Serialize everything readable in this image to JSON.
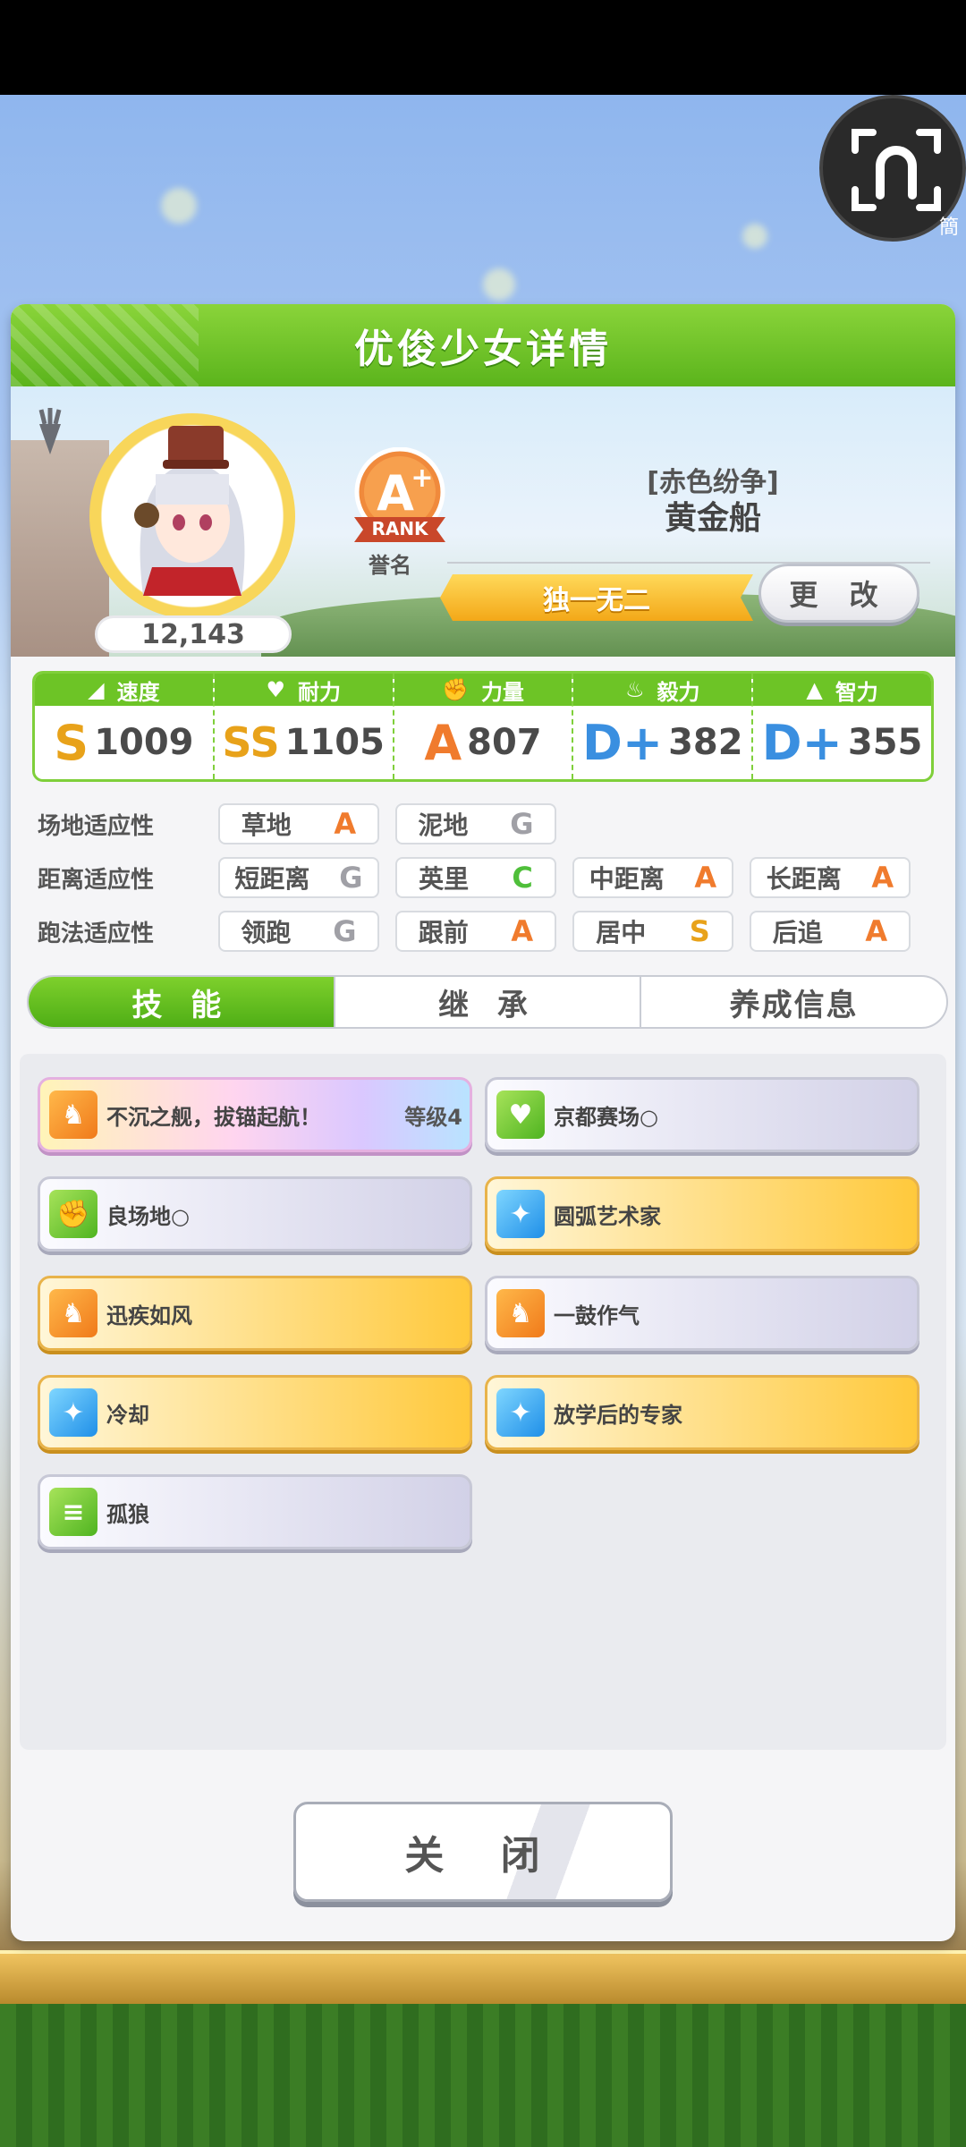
{
  "float_button": {
    "lang": "簡"
  },
  "panel": {
    "title": "优俊少女详情"
  },
  "profile": {
    "fans": "12,143",
    "rank_label": "RANK",
    "rank_grade": "A+",
    "rank_caption": "誉名",
    "epithet": "[赤色纷争]",
    "name": "黄金船",
    "title": "独一无二",
    "change_label": "更 改"
  },
  "stats": [
    {
      "label": "速度",
      "icon": "shoe-icon",
      "grade": "S",
      "value": "1009"
    },
    {
      "label": "耐力",
      "icon": "heart-icon",
      "grade": "SS",
      "value": "1105"
    },
    {
      "label": "力量",
      "icon": "muscle-icon",
      "grade": "A",
      "value": "807"
    },
    {
      "label": "毅力",
      "icon": "flame-icon",
      "grade": "D+",
      "value": "382"
    },
    {
      "label": "智力",
      "icon": "graduation-cap-icon",
      "grade": "D+",
      "value": "355"
    }
  ],
  "aptitudes": {
    "track": {
      "label": "场地适应性",
      "items": [
        {
          "name": "草地",
          "grade": "A"
        },
        {
          "name": "泥地",
          "grade": "G"
        }
      ]
    },
    "distance": {
      "label": "距离适应性",
      "items": [
        {
          "name": "短距离",
          "grade": "G"
        },
        {
          "name": "英里",
          "grade": "C"
        },
        {
          "name": "中距离",
          "grade": "A"
        },
        {
          "name": "长距离",
          "grade": "A"
        }
      ]
    },
    "style": {
      "label": "跑法适应性",
      "items": [
        {
          "name": "领跑",
          "grade": "G"
        },
        {
          "name": "跟前",
          "grade": "A"
        },
        {
          "name": "居中",
          "grade": "S"
        },
        {
          "name": "后追",
          "grade": "A"
        }
      ]
    }
  },
  "tabs": [
    {
      "label": "技 能"
    },
    {
      "label": "继 承"
    },
    {
      "label": "养成信息"
    }
  ],
  "skills": [
    {
      "name": "不沉之舰，拔锚起航！",
      "level": "等级4",
      "style": "rainbow",
      "icon": "running-horse-icon"
    },
    {
      "name": "京都赛场○",
      "level": "",
      "style": "normal",
      "icon": "heart-icon"
    },
    {
      "name": "良场地○",
      "level": "",
      "style": "normal",
      "icon": "muscle-icon"
    },
    {
      "name": "圆弧艺术家",
      "level": "",
      "style": "gold",
      "icon": "sparkle-icon"
    },
    {
      "name": "迅疾如风",
      "level": "",
      "style": "gold",
      "icon": "running-horse-icon"
    },
    {
      "name": "一鼓作气",
      "level": "",
      "style": "normal",
      "icon": "running-horse-icon"
    },
    {
      "name": "冷却",
      "level": "",
      "style": "gold",
      "icon": "sparkle-icon"
    },
    {
      "name": "放学后的专家",
      "level": "",
      "style": "gold",
      "icon": "sparkle-icon"
    },
    {
      "name": "孤狼",
      "level": "",
      "style": "normal",
      "icon": "document-icon"
    }
  ],
  "close_label": "关 闭"
}
